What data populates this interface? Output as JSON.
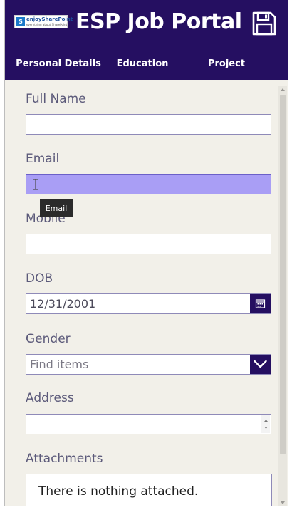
{
  "app": {
    "title": "ESP Job Portal",
    "logo_brand": "enjoySharePoint",
    "logo_tagline": "everything about SharePoint"
  },
  "nav": {
    "tabs": [
      {
        "label": "Personal Details"
      },
      {
        "label": "Education"
      },
      {
        "label": "Project"
      }
    ]
  },
  "form": {
    "full_name": {
      "label": "Full Name",
      "value": ""
    },
    "email": {
      "label": "Email",
      "value": "",
      "tooltip": "Email"
    },
    "mobile": {
      "label": "Mobile",
      "value": ""
    },
    "dob": {
      "label": "DOB",
      "value": "12/31/2001"
    },
    "gender": {
      "label": "Gender",
      "placeholder": "Find items"
    },
    "address": {
      "label": "Address",
      "value": ""
    },
    "attachments": {
      "label": "Attachments",
      "empty_text": "There is nothing attached."
    }
  },
  "colors": {
    "header_bg": "#250f61",
    "form_bg": "#f2f0e9",
    "focus_bg": "#a99ef5",
    "label": "#5c5a7a"
  },
  "icons": {
    "save": "floppy-disk-icon",
    "calendar": "calendar-icon",
    "dropdown": "chevron-down-icon",
    "cursor": "text-cursor-icon"
  }
}
